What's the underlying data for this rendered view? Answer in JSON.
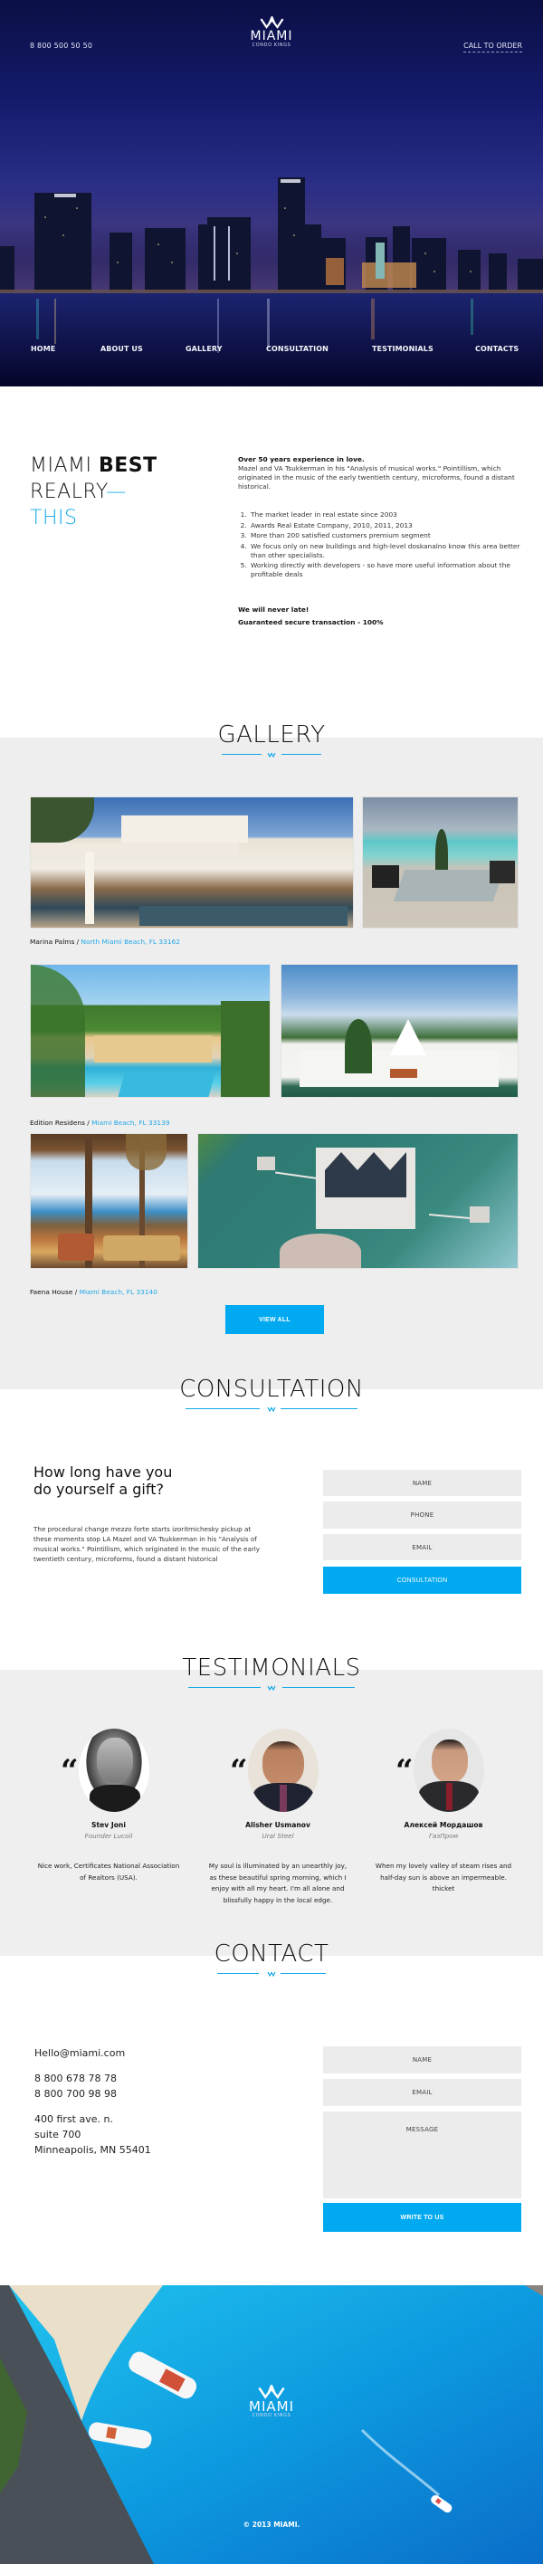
{
  "header": {
    "phone": "8 800 500 50 50",
    "call_to_order": "CALL TO ORDER",
    "logo": {
      "word": "MIAMI",
      "tm": "™",
      "sub": "CONDO KINGS"
    }
  },
  "nav": {
    "items": [
      {
        "label": "HOME"
      },
      {
        "label": "ABOUT US"
      },
      {
        "label": "GALLERY"
      },
      {
        "label": "CONSULTATION"
      },
      {
        "label": "TESTIMONIALS"
      },
      {
        "label": "CONTACTS"
      }
    ]
  },
  "about": {
    "title_part1": "MIAMI ",
    "title_bold": "BEST",
    "title_line2": "REALRY",
    "title_dash": "—",
    "title_line3": "THIS",
    "lead": "Over 50 years experience in love.",
    "intro": "Mazel and VA Tsukkerman in his \"Analysis of musical works.\" Pointillism, which originated in the music of the early twentieth century, microforms, found a distant historical.",
    "list": [
      "The market leader in real estate since 2003",
      "Awards Real Estate Company, 2010, 2011, 2013",
      "More than 200 satisfied customers premium segment",
      "We focus only on new buildings and high-level doskanalno know this area better than other specialists.",
      "Working directly with developers - so have more useful information about the profitable deals"
    ],
    "closing1": "We will never late!",
    "closing2": "Guaranteed secure transaction - 100%"
  },
  "gallery": {
    "title": "GALLERY",
    "items": [
      {
        "name": "Marina Palms",
        "sep": " / ",
        "location": "North Miami Beach, FL 33162"
      },
      {
        "name": "Edition Residens",
        "sep": " / ",
        "location": "Miami Beach, FL 33139"
      },
      {
        "name": "Faena House",
        "sep": " / ",
        "location": "Miami Beach, FL 33140"
      }
    ],
    "view_all": "VIEW ALL"
  },
  "consultation": {
    "title": "CONSULTATION",
    "heading": "How long have you do yourself a gift?",
    "text": "The procedural change mezzo forte starts izoritmichesky pickup at these moments stop LA Mazel and VA Tsukkerman in his \"Analysis of musical works.\" Pointillism, which originated in the music of the early twentieth century, microforms, found a distant historical",
    "form": {
      "name_placeholder": "NAME",
      "phone_placeholder": "PHONE",
      "email_placeholder": "EMAIL",
      "submit": "CONSULTATION"
    }
  },
  "testimonials": {
    "title": "TESTIMONIALS",
    "quote_mark": "“",
    "items": [
      {
        "name": "Stev Joni",
        "role": "Founder Lucoil",
        "text": "Nice work, Certificates National Association of Realtors (USA)."
      },
      {
        "name": "Alisher Usmanov",
        "role": "Ural Steel",
        "text": "My soul is illuminated by an unearthly joy, as these beautiful spring morning, which I enjoy with all my heart. I'm all alone and blissfully happy in the local edge."
      },
      {
        "name": "Алексей Мордашов",
        "role": "ГазПром",
        "text": "When my lovely valley of steam rises and half-day sun is above an impermeable. thicket"
      }
    ]
  },
  "contact": {
    "title": "CONTACT",
    "email": "Hello@miami.com",
    "phones": "8 800 678 78 78\n8 800 700 98 98",
    "address": "400 first ave. n.\nsuite 700\nMinneapolis, MN 55401",
    "form": {
      "name_placeholder": "NAME",
      "email_placeholder": "EMAIL",
      "message_placeholder": "MESSAGE",
      "submit": "WRITE TO US"
    }
  },
  "footer": {
    "copyright": "© 2013 MIAMI."
  },
  "colors": {
    "accent": "#00a9f0",
    "hero_bg": "#0b0f45",
    "section_gray": "#eeeeee"
  }
}
